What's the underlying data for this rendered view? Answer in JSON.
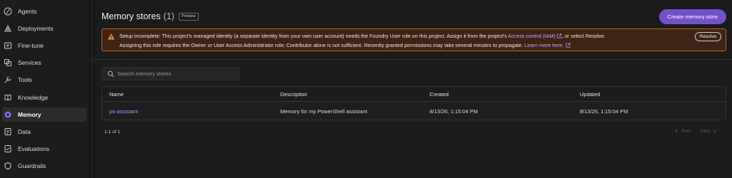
{
  "sidebar": {
    "items": [
      {
        "label": "Agents",
        "icon": "agents-icon"
      },
      {
        "label": "Deployments",
        "icon": "deployments-icon"
      },
      {
        "label": "Fine-tune",
        "icon": "fine-tune-icon"
      },
      {
        "label": "Services",
        "icon": "services-icon"
      },
      {
        "label": "Tools",
        "icon": "tools-icon"
      },
      {
        "label": "Knowledge",
        "icon": "knowledge-icon"
      },
      {
        "label": "Memory",
        "icon": "memory-icon",
        "active": true
      },
      {
        "label": "Data",
        "icon": "data-icon"
      },
      {
        "label": "Evaluations",
        "icon": "evaluations-icon"
      },
      {
        "label": "Guardrails",
        "icon": "guardrails-icon"
      }
    ]
  },
  "header": {
    "title": "Memory stores",
    "count": "(1)",
    "badge": "Preview",
    "create_button": "Create memory store"
  },
  "warning": {
    "text_1": "Setup incomplete: This project's managed identity (a separate identity from your own user account) needs the Foundry User role on this project. Assign it from the project's ",
    "link_1": "Access control (IAM)",
    "text_2": ", or select Resolve.",
    "text_3": "Assigning this role requires the Owner or User Access Administrator role; Contributor alone is not sufficient. Recently granted permissions may take several minutes to propagate. ",
    "link_2": "Learn more here.",
    "resolve_button": "Resolve"
  },
  "search": {
    "placeholder": "Search memory stores",
    "value": ""
  },
  "table": {
    "columns": [
      "Name",
      "Description",
      "Created",
      "Updated"
    ],
    "rows": [
      {
        "name": "ps-assistant",
        "description": "Memory for my PowerShell assistant",
        "created": "8/13/26, 1:15:04 PM",
        "updated": "8/13/26, 1:15:04 PM"
      }
    ]
  },
  "pagination": {
    "info": "1-1 of 1",
    "prev": "Prev",
    "next": "Next"
  },
  "colors": {
    "accent": "#7550c9",
    "link": "#b892ff",
    "warning_border": "#c1602a",
    "warning_bg": "#3d2414",
    "warning_icon": "#e8853f"
  }
}
